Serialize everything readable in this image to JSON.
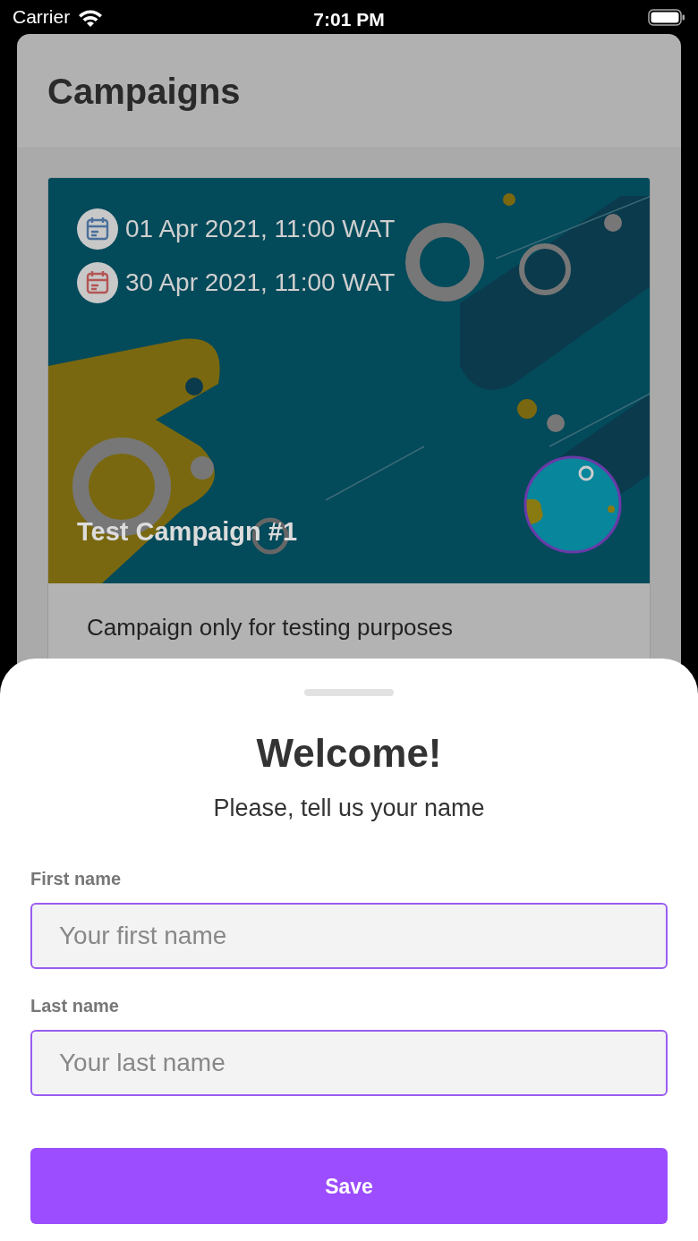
{
  "status_bar": {
    "carrier": "Carrier",
    "time": "7:01 PM"
  },
  "page": {
    "title": "Campaigns"
  },
  "campaigns": [
    {
      "dates": [
        {
          "kind": "start",
          "text": "01 Apr 2021, 11:00 WAT"
        },
        {
          "kind": "end",
          "text": "30 Apr 2021, 11:00 WAT"
        }
      ],
      "name": "Test Campaign #1",
      "description": "Campaign only for testing purposes"
    }
  ],
  "sheet": {
    "title": "Welcome!",
    "subtitle": "Please, tell us your name",
    "fields": [
      {
        "label": "First name",
        "placeholder": "Your first name"
      },
      {
        "label": "Last name",
        "placeholder": "Your last name"
      }
    ],
    "button": "Save"
  }
}
